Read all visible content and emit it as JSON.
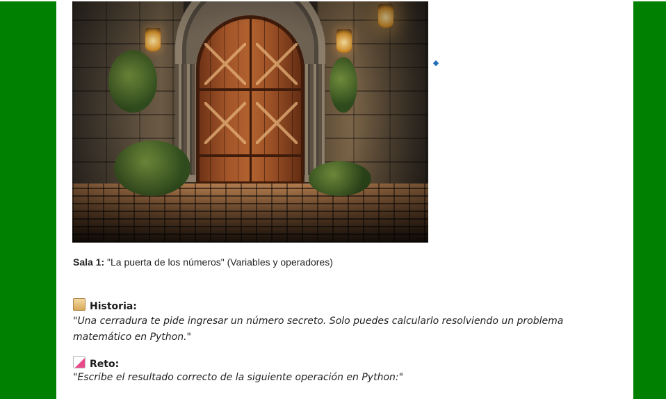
{
  "room": {
    "label_bold": "Sala 1:",
    "label_rest": " \"La puerta de los números\" (Variables y operadores)"
  },
  "historia": {
    "heading": "Historia:",
    "text": "\"Una cerradura  te pide ingresar un número secreto. Solo puedes calcularlo resolviendo un problema matemático en Python.\""
  },
  "reto": {
    "heading": "Reto:",
    "text": "\"Escribe el resultado correcto de la siguiente operación en Python:\""
  },
  "icons": {
    "historia": "scroll-icon",
    "reto": "memo-icon"
  },
  "colors": {
    "background": "#008000",
    "page": "#ffffff",
    "bullet": "#2170b8"
  }
}
